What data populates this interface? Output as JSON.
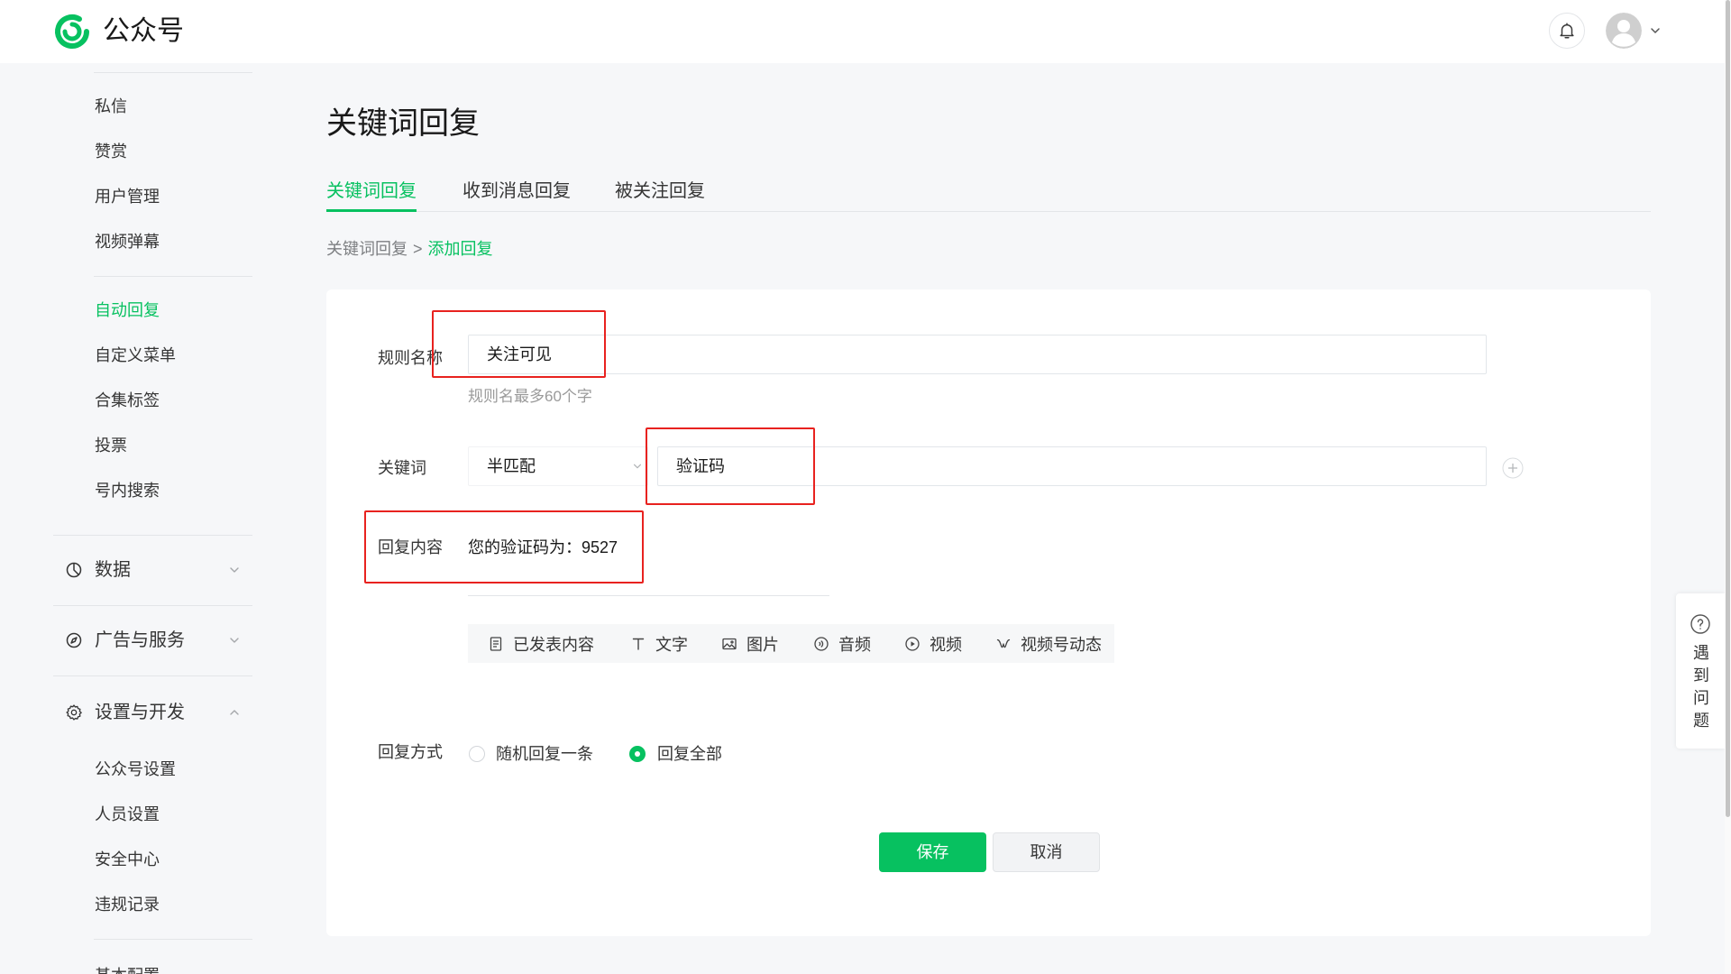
{
  "colors": {
    "accent": "#07c160",
    "highlight": "#e8221f"
  },
  "header": {
    "brand": "公众号",
    "logo_icon": "wechat-official-account-logo-icon",
    "notification_icon": "bell-icon",
    "avatar_icon": "avatar-icon",
    "account_menu_icon": "chevron-down-icon"
  },
  "sidebar": {
    "top_items": [
      {
        "label": "私信"
      },
      {
        "label": "赞赏"
      },
      {
        "label": "用户管理"
      },
      {
        "label": "视频弹幕"
      }
    ],
    "reply_items": [
      {
        "label": "自动回复",
        "active": true
      },
      {
        "label": "自定义菜单"
      },
      {
        "label": "合集标签"
      },
      {
        "label": "投票"
      },
      {
        "label": "号内搜索"
      }
    ],
    "sections": [
      {
        "label": "数据",
        "icon": "pie-chart-icon",
        "expanded": false
      },
      {
        "label": "广告与服务",
        "icon": "compass-icon",
        "expanded": false
      },
      {
        "label": "设置与开发",
        "icon": "gear-icon",
        "expanded": true,
        "items": [
          {
            "label": "公众号设置"
          },
          {
            "label": "人员设置"
          },
          {
            "label": "安全中心"
          },
          {
            "label": "违规记录"
          }
        ]
      }
    ],
    "more_items": [
      {
        "label": "基本配置"
      }
    ]
  },
  "main": {
    "title": "关键词回复",
    "tabs": [
      {
        "label": "关键词回复",
        "active": true
      },
      {
        "label": "收到消息回复",
        "active": false
      },
      {
        "label": "被关注回复",
        "active": false
      }
    ],
    "breadcrumb": {
      "parent": "关键词回复",
      "separator": ">",
      "current": "添加回复"
    },
    "form": {
      "rule_name": {
        "label": "规则名称",
        "value": "关注可见",
        "hint": "规则名最多60个字"
      },
      "keyword": {
        "label": "关键词",
        "match_mode": "半匹配",
        "value": "验证码",
        "add_icon": "plus-circle-icon"
      },
      "reply_content": {
        "label": "回复内容",
        "value": "您的验证码为：9527",
        "toolbar": [
          {
            "label": "已发表内容",
            "icon": "document-icon"
          },
          {
            "label": "文字",
            "icon": "text-icon"
          },
          {
            "label": "图片",
            "icon": "image-icon"
          },
          {
            "label": "音频",
            "icon": "audio-icon"
          },
          {
            "label": "视频",
            "icon": "video-icon"
          },
          {
            "label": "视频号动态",
            "icon": "channels-icon"
          }
        ]
      },
      "reply_mode": {
        "label": "回复方式",
        "options": [
          {
            "label": "随机回复一条",
            "selected": false
          },
          {
            "label": "回复全部",
            "selected": true
          }
        ]
      },
      "save_label": "保存",
      "cancel_label": "取消"
    }
  },
  "help": {
    "icon": "question-circle-icon",
    "label": "遇到问题"
  }
}
